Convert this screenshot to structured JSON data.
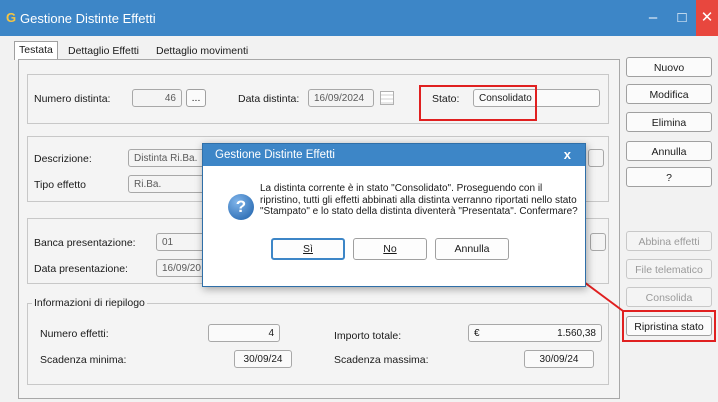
{
  "window": {
    "logo": "G",
    "title": "Gestione Distinte Effetti",
    "min": "–",
    "max": "□",
    "close": "✕"
  },
  "tabs": [
    "Testata",
    "Dettaglio Effetti",
    "Dettaglio movimenti"
  ],
  "header": {
    "numero_label": "Numero distinta:",
    "numero_value": "46",
    "lookup_label": "...",
    "data_label": "Data distinta:",
    "data_value": "16/09/2024",
    "stato_label": "Stato:",
    "stato_value": "Consolidato"
  },
  "descr": {
    "descr_label": "Descrizione:",
    "descr_value": "Distinta Ri.Ba.",
    "tipo_label": "Tipo effetto",
    "tipo_value": "Ri.Ba."
  },
  "banca": {
    "banca_label": "Banca presentazione:",
    "banca_value": "01",
    "data_label": "Data presentazione:",
    "data_value": "16/09/20"
  },
  "riepilogo": {
    "title": "Informazioni di riepilogo",
    "num_label": "Numero effetti:",
    "num_value": "4",
    "imp_label": "Importo totale:",
    "imp_currency": "€",
    "imp_value": "1.560,38",
    "smin_label": "Scadenza minima:",
    "smin_value": "30/09/24",
    "smax_label": "Scadenza massima:",
    "smax_value": "30/09/24"
  },
  "sidebar": {
    "nuovo": "Nuovo",
    "modifica": "Modifica",
    "elimina": "Elimina",
    "annulla": "Annulla",
    "help": "?",
    "abbina": "Abbina effetti",
    "file": "File telematico",
    "consolida": "Consolida",
    "ripristina": "Ripristina stato"
  },
  "dialog": {
    "title": "Gestione Distinte Effetti",
    "close": "x",
    "icon": "?",
    "message": "La distinta corrente è in stato \"Consolidato\". Proseguendo con il ripristino, tutti gli effetti abbinati alla distinta verranno riportati nello stato \"Stampato\" e lo stato della distinta diventerà \"Presentata\". Confermare?",
    "si": "Sì",
    "no": "No",
    "annulla": "Annulla"
  },
  "colors": {
    "titlebar": "#3d86c7",
    "highlight": "#e02020",
    "close": "#e8473e"
  }
}
